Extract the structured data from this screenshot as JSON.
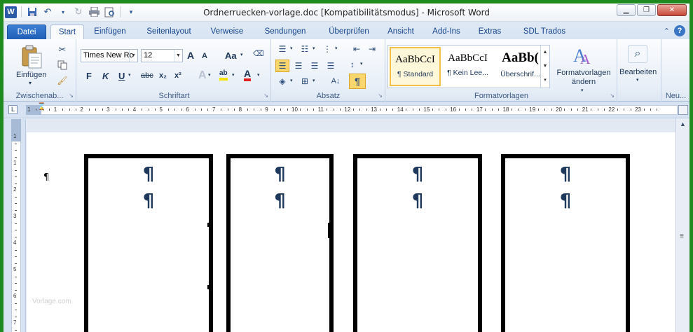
{
  "window": {
    "title": "Ordnerruecken-vorlage.doc [Kompatibilitätsmodus]  -  Microsoft Word"
  },
  "qat": {
    "app_icon": "W"
  },
  "tabs": [
    "Datei",
    "Start",
    "Einfügen",
    "Seitenlayout",
    "Verweise",
    "Sendungen",
    "Überprüfen",
    "Ansicht",
    "Add-Ins",
    "Extras",
    "SDL Trados"
  ],
  "ribbon": {
    "clipboard": {
      "label": "Zwischenab...",
      "paste": "Einfügen"
    },
    "font": {
      "label": "Schriftart",
      "name": "Times New Rc",
      "size": "12",
      "case_btn": "Aa",
      "bold": "F",
      "italic": "K",
      "underline": "U",
      "strike": "abc",
      "sub": "x₂",
      "sup": "x²",
      "grow": "A",
      "shrink": "A",
      "color": "A",
      "highlight": "ab"
    },
    "paragraph": {
      "label": "Absatz",
      "pilcrow": "¶"
    },
    "styles": {
      "label": "Formatvorlagen",
      "items": [
        {
          "sample": "AaBbCcI",
          "name": "¶ Standard"
        },
        {
          "sample": "AaBbCcI",
          "name": "¶ Kein Lee..."
        },
        {
          "sample": "AaBb(",
          "name": "Überschrif..."
        }
      ],
      "change_label": "Formatvorlagen ändern"
    },
    "editing": {
      "label": "Bearbeiten"
    },
    "new_group": {
      "label": "Neu..."
    }
  },
  "ruler": {
    "numbers": [
      "1",
      "1",
      "2",
      "3",
      "4",
      "5",
      "6",
      "7",
      "8",
      "9",
      "10",
      "11",
      "12",
      "13",
      "14",
      "15",
      "16",
      "17",
      "18",
      "19",
      "20",
      "21",
      "22",
      "23"
    ],
    "vnumbers": [
      "1",
      "1",
      "2",
      "3",
      "4",
      "5",
      "6",
      "7"
    ]
  },
  "document": {
    "pilcrow": "¶",
    "spine_marks": [
      "¶",
      "¶"
    ],
    "watermark": "Vorlage.com"
  },
  "colors": {
    "frame": "#1f8a1f",
    "file_tab": "#2a66c0",
    "ribbon_bg": "#e7eef7"
  }
}
